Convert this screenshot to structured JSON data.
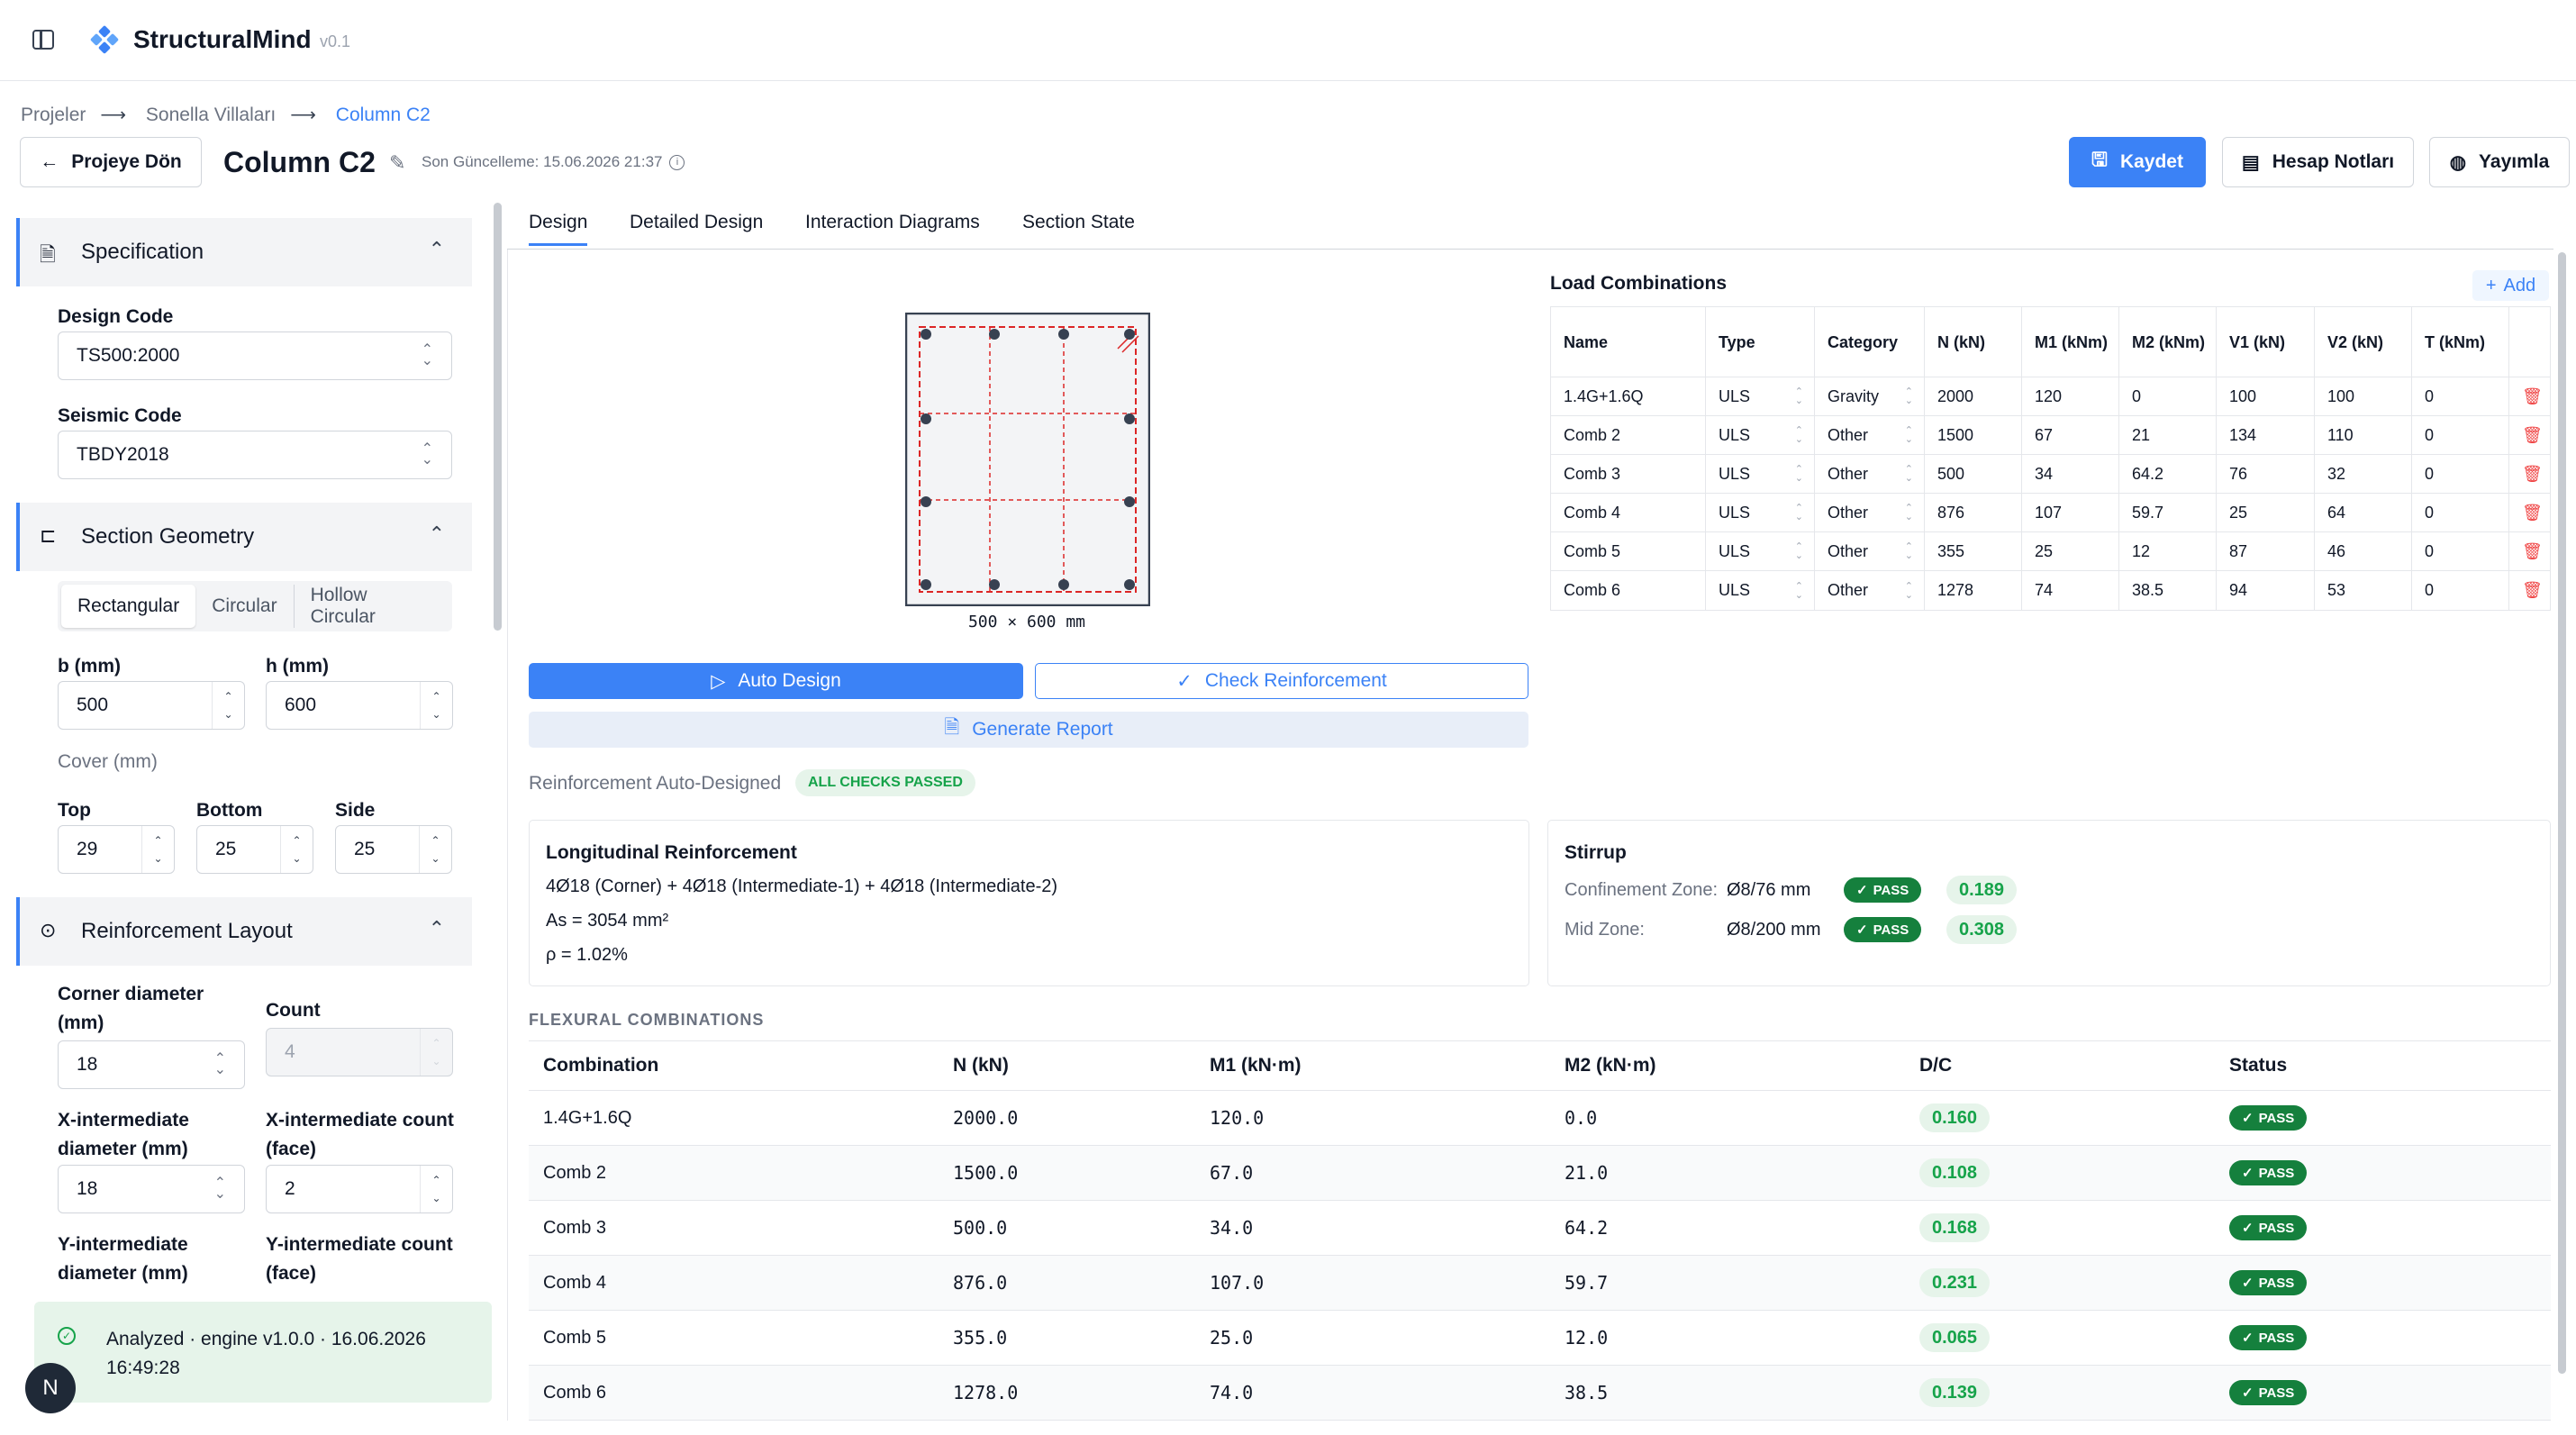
{
  "app": {
    "name": "StructuralMind",
    "version": "v0.1"
  },
  "breadcrumb": [
    "Projeler",
    "Sonella Villaları",
    "Column C2"
  ],
  "header": {
    "back_label": "Projeye Dön",
    "title": "Column C2",
    "updated": "Son Güncelleme: 15.06.2026 21:37",
    "save_label": "Kaydet",
    "notes_label": "Hesap Notları",
    "publish_label": "Yayımla"
  },
  "sidebar": {
    "spec_title": "Specification",
    "design_code_label": "Design Code",
    "design_code": "TS500:2000",
    "seismic_code_label": "Seismic Code",
    "seismic_code": "TBDY2018",
    "geom_title": "Section Geometry",
    "shapes": [
      "Rectangular",
      "Circular",
      "Hollow Circular"
    ],
    "b_label": "b (mm)",
    "b": "500",
    "h_label": "h (mm)",
    "h": "600",
    "cover_label": "Cover (mm)",
    "top_label": "Top",
    "top": "29",
    "bottom_label": "Bottom",
    "bottom": "25",
    "side_label": "Side",
    "side": "25",
    "reinf_title": "Reinforcement Layout",
    "corner_diam_label": "Corner diameter (mm)",
    "corner_diam": "18",
    "count_label": "Count",
    "count": "4",
    "xint_diam_label": "X-intermediate diameter (mm)",
    "xint_diam": "18",
    "xint_count_label": "X-intermediate count (face)",
    "xint_count": "2",
    "yint_diam_label": "Y-intermediate diameter (mm)",
    "yint_count_label": "Y-intermediate count (face)",
    "status": "Analyzed · engine v1.0.0 · 16.06.2026 16:49:28",
    "nav_badge": "N"
  },
  "tabs": [
    "Design",
    "Detailed Design",
    "Interaction Diagrams",
    "Section State"
  ],
  "design": {
    "section_dims": "500 × 600 mm",
    "auto_design": "Auto Design",
    "check_reinf": "Check Reinforcement",
    "gen_report": "Generate Report",
    "auto_label": "Reinforcement Auto-Designed",
    "all_passed": "ALL CHECKS PASSED",
    "long": {
      "title": "Longitudinal Reinforcement",
      "bars": "4Ø18 (Corner) + 4Ø18 (Intermediate-1) + 4Ø18 (Intermediate-2)",
      "as": "As = 3054 mm²",
      "rho": "ρ = 1.02%"
    },
    "stirrup": {
      "title": "Stirrup",
      "conf_label": "Confinement Zone:",
      "conf_val": "Ø8/76 mm",
      "conf_dc": "0.189",
      "mid_label": "Mid Zone:",
      "mid_val": "Ø8/200 mm",
      "mid_dc": "0.308",
      "pass": "PASS"
    },
    "flex_title": "FLEXURAL COMBINATIONS",
    "flex_headers": [
      "Combination",
      "N (kN)",
      "M1 (kN·m)",
      "M2 (kN·m)",
      "D/C",
      "Status"
    ],
    "flex_rows": [
      [
        "1.4G+1.6Q",
        "2000.0",
        "120.0",
        "0.0",
        "0.160",
        "PASS"
      ],
      [
        "Comb 2",
        "1500.0",
        "67.0",
        "21.0",
        "0.108",
        "PASS"
      ],
      [
        "Comb 3",
        "500.0",
        "34.0",
        "64.2",
        "0.168",
        "PASS"
      ],
      [
        "Comb 4",
        "876.0",
        "107.0",
        "59.7",
        "0.231",
        "PASS"
      ],
      [
        "Comb 5",
        "355.0",
        "25.0",
        "12.0",
        "0.065",
        "PASS"
      ],
      [
        "Comb 6",
        "1278.0",
        "74.0",
        "38.5",
        "0.139",
        "PASS"
      ]
    ]
  },
  "load_combos": {
    "title": "Load Combinations",
    "add_label": "Add",
    "headers": [
      "Name",
      "Type",
      "Category",
      "N (kN)",
      "M1 (kNm)",
      "M2 (kNm)",
      "V1 (kN)",
      "V2 (kN)",
      "T (kNm)"
    ],
    "rows": [
      [
        "1.4G+1.6Q",
        "ULS",
        "Gravity",
        "2000",
        "120",
        "0",
        "100",
        "100",
        "0"
      ],
      [
        "Comb 2",
        "ULS",
        "Other",
        "1500",
        "67",
        "21",
        "134",
        "110",
        "0"
      ],
      [
        "Comb 3",
        "ULS",
        "Other",
        "500",
        "34",
        "64.2",
        "76",
        "32",
        "0"
      ],
      [
        "Comb 4",
        "ULS",
        "Other",
        "876",
        "107",
        "59.7",
        "25",
        "64",
        "0"
      ],
      [
        "Comb 5",
        "ULS",
        "Other",
        "355",
        "25",
        "12",
        "87",
        "46",
        "0"
      ],
      [
        "Comb 6",
        "ULS",
        "Other",
        "1278",
        "74",
        "38.5",
        "94",
        "53",
        "0"
      ]
    ]
  },
  "colors": {
    "accent": "#3b82f6",
    "pass": "#15803d",
    "pass_bg": "#e6f4ea",
    "danger": "#ef4444"
  }
}
